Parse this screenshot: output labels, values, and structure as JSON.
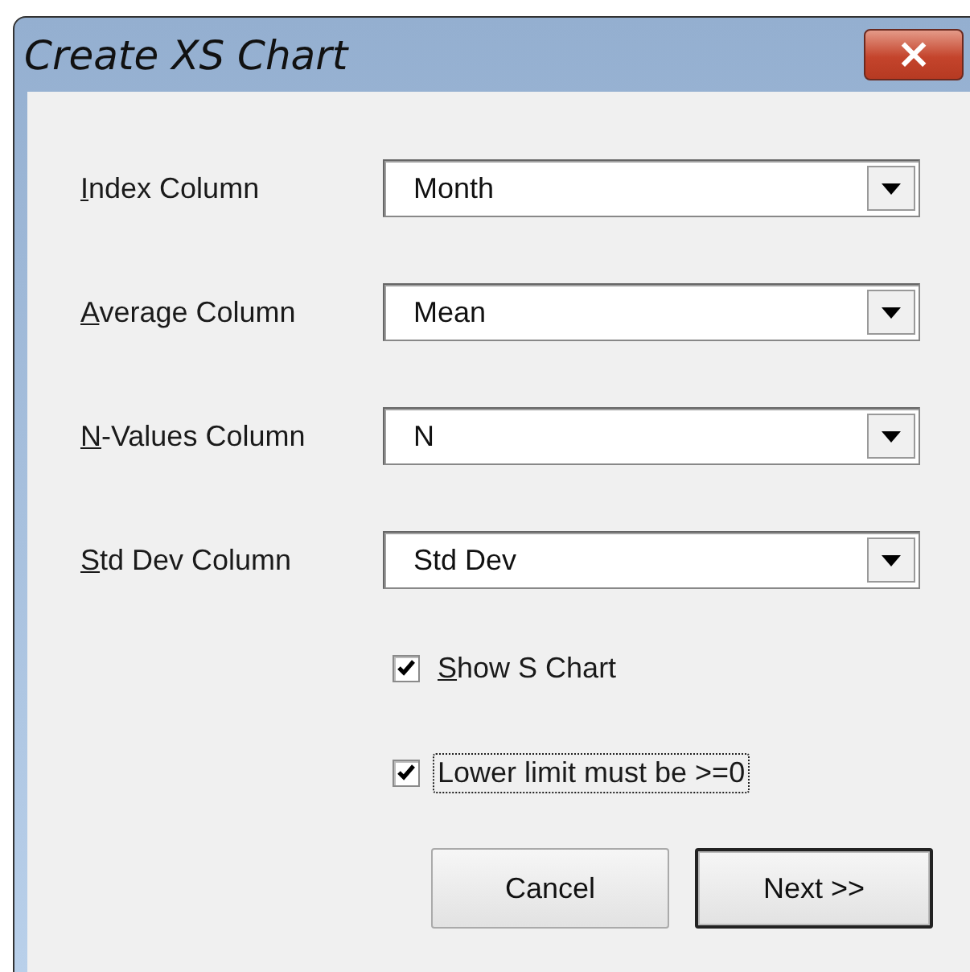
{
  "window": {
    "title": "Create XS Chart",
    "close": "×"
  },
  "fields": [
    {
      "access_key": "I",
      "label_rest": "ndex Column",
      "value": "Month"
    },
    {
      "access_key": "A",
      "label_rest": "verage Column",
      "value": "Mean"
    },
    {
      "access_key": "N",
      "label_rest": "-Values Column",
      "value": "N"
    },
    {
      "access_key": "S",
      "label_rest": "td Dev Column",
      "value": "Std Dev"
    }
  ],
  "checkboxes": [
    {
      "access_key": "S",
      "label_rest": "how S Chart",
      "checked": true,
      "focused": false
    },
    {
      "label": "Lower limit must be >=0",
      "checked": true,
      "focused": true
    }
  ],
  "buttons": [
    {
      "label": "Cancel",
      "default": false
    },
    {
      "label": "Next >>",
      "default": true
    }
  ]
}
